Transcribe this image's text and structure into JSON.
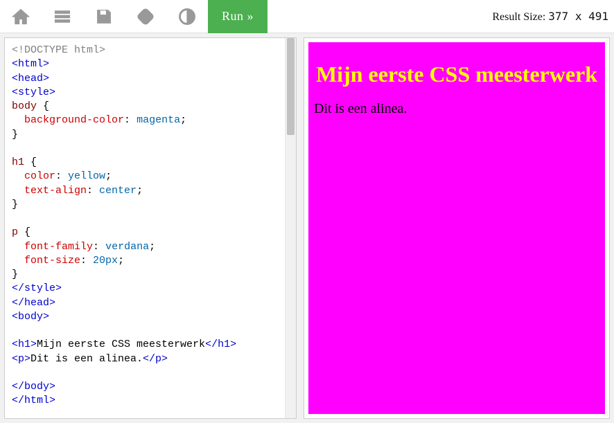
{
  "toolbar": {
    "icons": {
      "home": "home-icon",
      "menu": "menu-icon",
      "save": "save-icon",
      "rotate": "rotate-icon",
      "theme": "theme-icon"
    },
    "run_label": "Run »"
  },
  "header": {
    "result_size_label": "Result Size:",
    "result_width": "377",
    "result_x": "x",
    "result_height": "491"
  },
  "editor": {
    "lines": [
      {
        "t": "doctype",
        "v": "<!DOCTYPE html>"
      },
      {
        "t": "tag",
        "v": "<html>"
      },
      {
        "t": "tag",
        "v": "<head>"
      },
      {
        "t": "tag",
        "v": "<style>"
      },
      {
        "t": "css_sel",
        "sel": "body",
        "open": " {"
      },
      {
        "t": "css_decl",
        "indent": "  ",
        "prop": "background-color",
        "val": "magenta",
        "end": ";"
      },
      {
        "t": "brace",
        "v": "}"
      },
      {
        "t": "blank",
        "v": ""
      },
      {
        "t": "css_sel",
        "sel": "h1",
        "open": " {"
      },
      {
        "t": "css_decl",
        "indent": "  ",
        "prop": "color",
        "val": "yellow",
        "end": ";"
      },
      {
        "t": "css_decl",
        "indent": "  ",
        "prop": "text-align",
        "val": "center",
        "end": ";"
      },
      {
        "t": "brace",
        "v": "}"
      },
      {
        "t": "blank",
        "v": ""
      },
      {
        "t": "css_sel",
        "sel": "p",
        "open": " {"
      },
      {
        "t": "css_decl",
        "indent": "  ",
        "prop": "font-family",
        "val": "verdana",
        "end": ";"
      },
      {
        "t": "css_decl",
        "indent": "  ",
        "prop": "font-size",
        "val": "20px",
        "end": ";"
      },
      {
        "t": "brace",
        "v": "}"
      },
      {
        "t": "tag",
        "v": "</style>"
      },
      {
        "t": "tag",
        "v": "</head>"
      },
      {
        "t": "tag",
        "v": "<body>"
      },
      {
        "t": "blank",
        "v": ""
      },
      {
        "t": "elem",
        "open": "<h1>",
        "body": "Mijn eerste CSS meesterwerk",
        "close": "</h1>"
      },
      {
        "t": "elem",
        "open": "<p>",
        "body": "Dit is een alinea.",
        "close": "</p>"
      },
      {
        "t": "blank",
        "v": ""
      },
      {
        "t": "tag",
        "v": "</body>"
      },
      {
        "t": "tag",
        "v": "</html>"
      }
    ]
  },
  "preview": {
    "heading": "Mijn eerste CSS meesterwerk",
    "paragraph": "Dit is een alinea."
  }
}
